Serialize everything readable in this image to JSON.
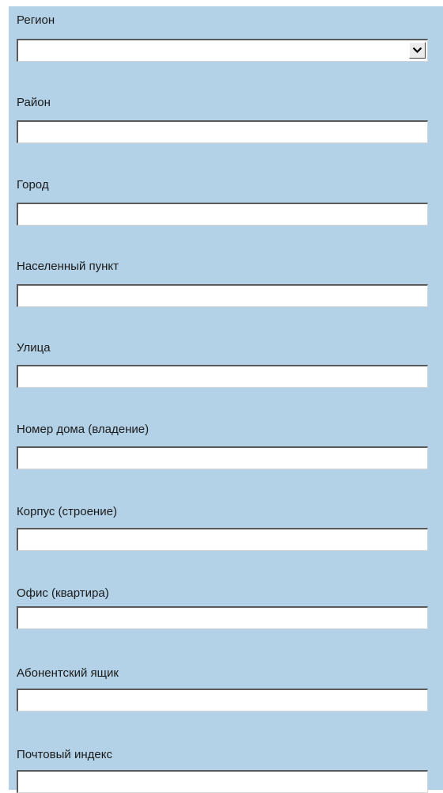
{
  "form": {
    "region": {
      "label": "Регион",
      "value": ""
    },
    "district": {
      "label": "Район",
      "value": ""
    },
    "city": {
      "label": "Город",
      "value": ""
    },
    "settlement": {
      "label": "Населенный пункт",
      "value": ""
    },
    "street": {
      "label": "Улица",
      "value": ""
    },
    "house": {
      "label": "Номер дома (владение)",
      "value": ""
    },
    "building": {
      "label": "Корпус (строение)",
      "value": ""
    },
    "office": {
      "label": "Офис (квартира)",
      "value": ""
    },
    "po_box": {
      "label": "Абонентский ящик",
      "value": ""
    },
    "postal_code": {
      "label": "Почтовый индекс",
      "value": ""
    }
  },
  "colors": {
    "panel_background": "#b4d2e7",
    "input_background": "#ffffff",
    "input_border_dark": "#5a5a5a"
  },
  "icons": {
    "region_dropdown": "chevron-down-icon"
  }
}
